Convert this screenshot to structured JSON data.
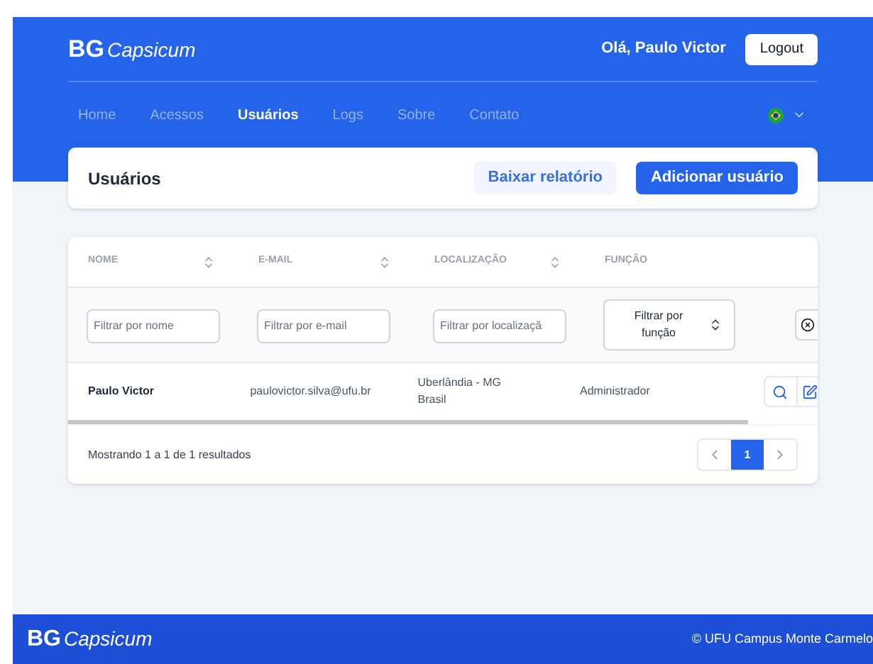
{
  "brand": {
    "initials": "BG",
    "name": "Capsicum"
  },
  "greeting": "Olá, Paulo Victor",
  "logout": "Logout",
  "nav": [
    {
      "label": "Home",
      "selected": false
    },
    {
      "label": "Acessos",
      "selected": false
    },
    {
      "label": "Usuários",
      "selected": true
    },
    {
      "label": "Logs",
      "selected": false
    },
    {
      "label": "Sobre",
      "selected": false
    },
    {
      "label": "Contato",
      "selected": false
    }
  ],
  "page_title": "Usuários",
  "actions": [
    {
      "label": "Baixar relatório",
      "kind": "secondary"
    },
    {
      "label": "Adicionar usuário",
      "kind": "primary"
    }
  ],
  "table": {
    "columns": [
      {
        "label": "NOME",
        "sortable": true
      },
      {
        "label": "E-MAIL",
        "sortable": true
      },
      {
        "label": "LOCALIZAÇÃO",
        "sortable": true
      },
      {
        "label": "FUNÇÃO",
        "sortable": false
      }
    ],
    "filters": [
      {
        "kind": "input",
        "placeholder": "Filtrar por nome"
      },
      {
        "kind": "input",
        "placeholder": "Filtrar por e-mail"
      },
      {
        "kind": "input",
        "placeholder": "Filtrar por localizaçã"
      },
      {
        "kind": "select",
        "value": "Filtrar por função"
      }
    ],
    "rows": [
      {
        "name": "Paulo Victor",
        "email": "paulovictor.silva@ufu.br",
        "location": [
          "Uberlândia - MG",
          "Brasil"
        ],
        "role": "Administrador"
      }
    ],
    "summary": "Mostrando 1 a 1 de 1 resultados",
    "pages": [
      {
        "label": "1",
        "selected": true
      }
    ]
  },
  "footer": {
    "brand": {
      "initials": "BG",
      "name": "Capsicum"
    },
    "copyright": "© UFU Campus Monte Carmelo"
  }
}
